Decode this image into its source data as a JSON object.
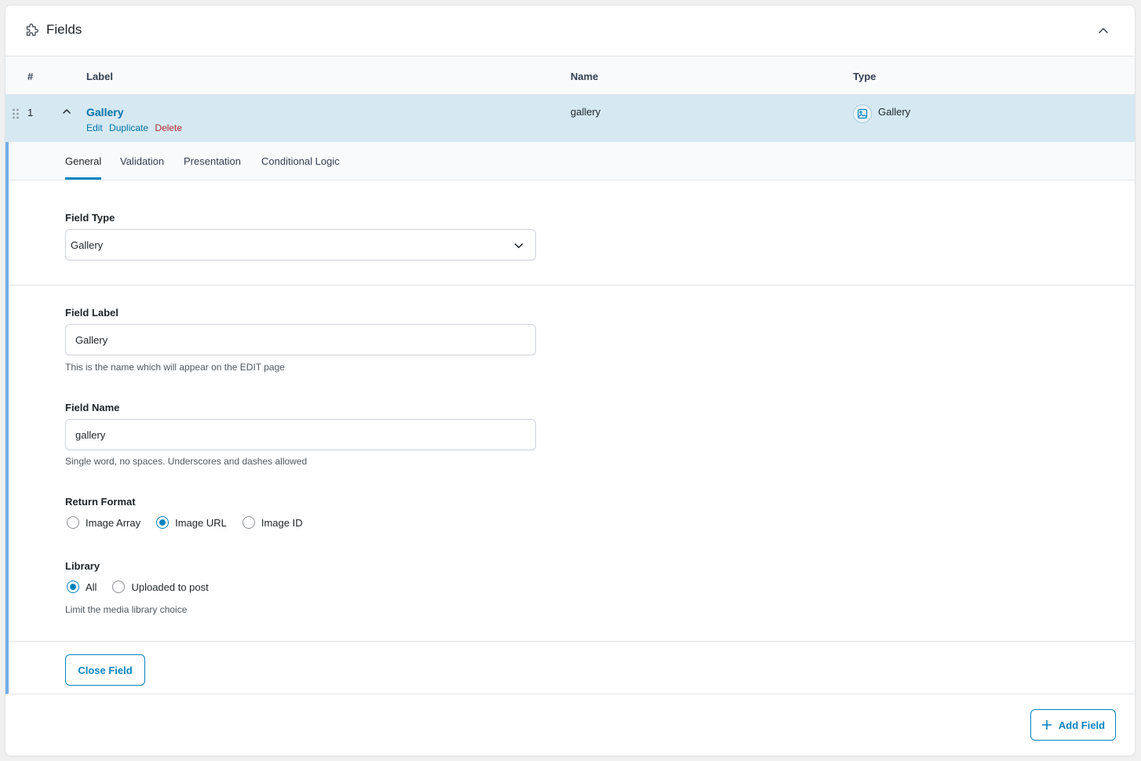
{
  "panel": {
    "title": "Fields",
    "icons": {
      "title_icon": "puzzle-icon",
      "collapse_icon": "chevron-up-icon"
    }
  },
  "table": {
    "columns": [
      "#",
      "Label",
      "Name",
      "Type"
    ]
  },
  "field_row": {
    "number": "1",
    "label": "Gallery",
    "actions": {
      "edit": "Edit",
      "duplicate": "Duplicate",
      "delete": "Delete"
    },
    "name": "gallery",
    "type": "Gallery",
    "type_icon": "image-icon"
  },
  "tabs": [
    {
      "label": "General",
      "active": true
    },
    {
      "label": "Validation",
      "active": false
    },
    {
      "label": "Presentation",
      "active": false
    },
    {
      "label": "Conditional Logic",
      "active": false
    }
  ],
  "general": {
    "field_type": {
      "label": "Field Type",
      "value": "Gallery"
    },
    "field_label": {
      "label": "Field Label",
      "value": "Gallery",
      "hint": "This is the name which will appear on the EDIT page"
    },
    "field_name": {
      "label": "Field Name",
      "value": "gallery",
      "hint": "Single word, no spaces. Underscores and dashes allowed"
    },
    "return_format": {
      "label": "Return Format",
      "options": [
        "Image Array",
        "Image URL",
        "Image ID"
      ],
      "selected": "Image URL"
    },
    "library": {
      "label": "Library",
      "options": [
        "All",
        "Uploaded to post"
      ],
      "selected": "All",
      "hint": "Limit the media library choice"
    }
  },
  "buttons": {
    "close_field": "Close Field",
    "add_field": "Add Field"
  },
  "colors": {
    "accent": "#0783be",
    "link": "#0073aa",
    "danger": "#b32d2e",
    "row_highlight": "#d6e9f3",
    "left_bar": "#72aee6"
  }
}
